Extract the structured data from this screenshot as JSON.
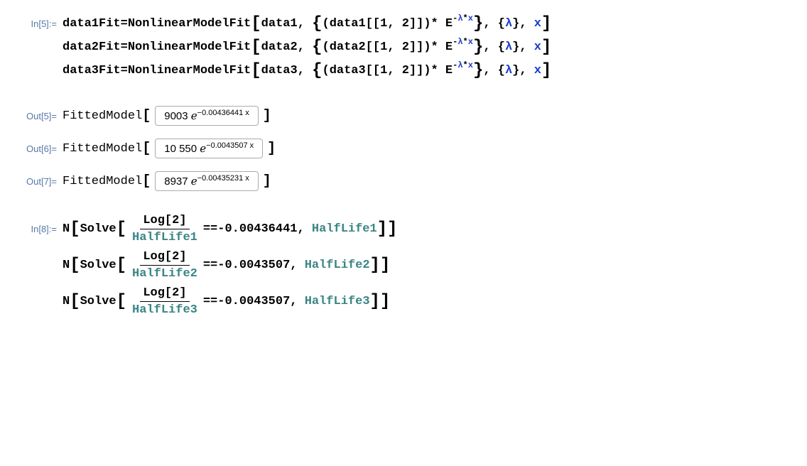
{
  "labels": {
    "in5": "In[5]:=",
    "out5": "Out[5]=",
    "out6": "Out[6]=",
    "out7": "Out[7]=",
    "in8": "In[8]:="
  },
  "inputs": {
    "line1": {
      "var": "data1Fit",
      "eq": " = ",
      "fn": "NonlinearModelFit",
      "arg1": "data1",
      "inner_pre": "(data1[[1, 2]])",
      "star": " * E",
      "expo": "-λ*x",
      "params": "{λ}",
      "xvar": "x"
    },
    "line2": {
      "var": "data2Fit",
      "arg1": "data2",
      "inner_pre": "(data2[[1, 2]])"
    },
    "line3": {
      "var": "data3Fit",
      "arg1": "data3",
      "inner_pre": "(data3[[1, 2]])"
    }
  },
  "outputs": {
    "fitted_label": "FittedModel",
    "out5_inner": "9003 ℯ",
    "out5_sup": "−0.00436441 x",
    "out6_inner": "10 550 ℯ",
    "out6_sup": "−0.0043507 x",
    "out7_inner": "8937 ℯ",
    "out7_sup": "−0.00435231 x"
  },
  "solve": {
    "N": "N",
    "Solve": "Solve",
    "Log": "Log[2]",
    "eqeq": " == ",
    "line1": {
      "den": "HalfLife1",
      "rhs": "-0.00436441",
      "param": "HalfLife1"
    },
    "line2": {
      "den": "HalfLife2",
      "rhs": "-0.0043507",
      "param": "HalfLife2"
    },
    "line3": {
      "den": "HalfLife3",
      "rhs": "-0.0043507",
      "param": "HalfLife3"
    }
  }
}
